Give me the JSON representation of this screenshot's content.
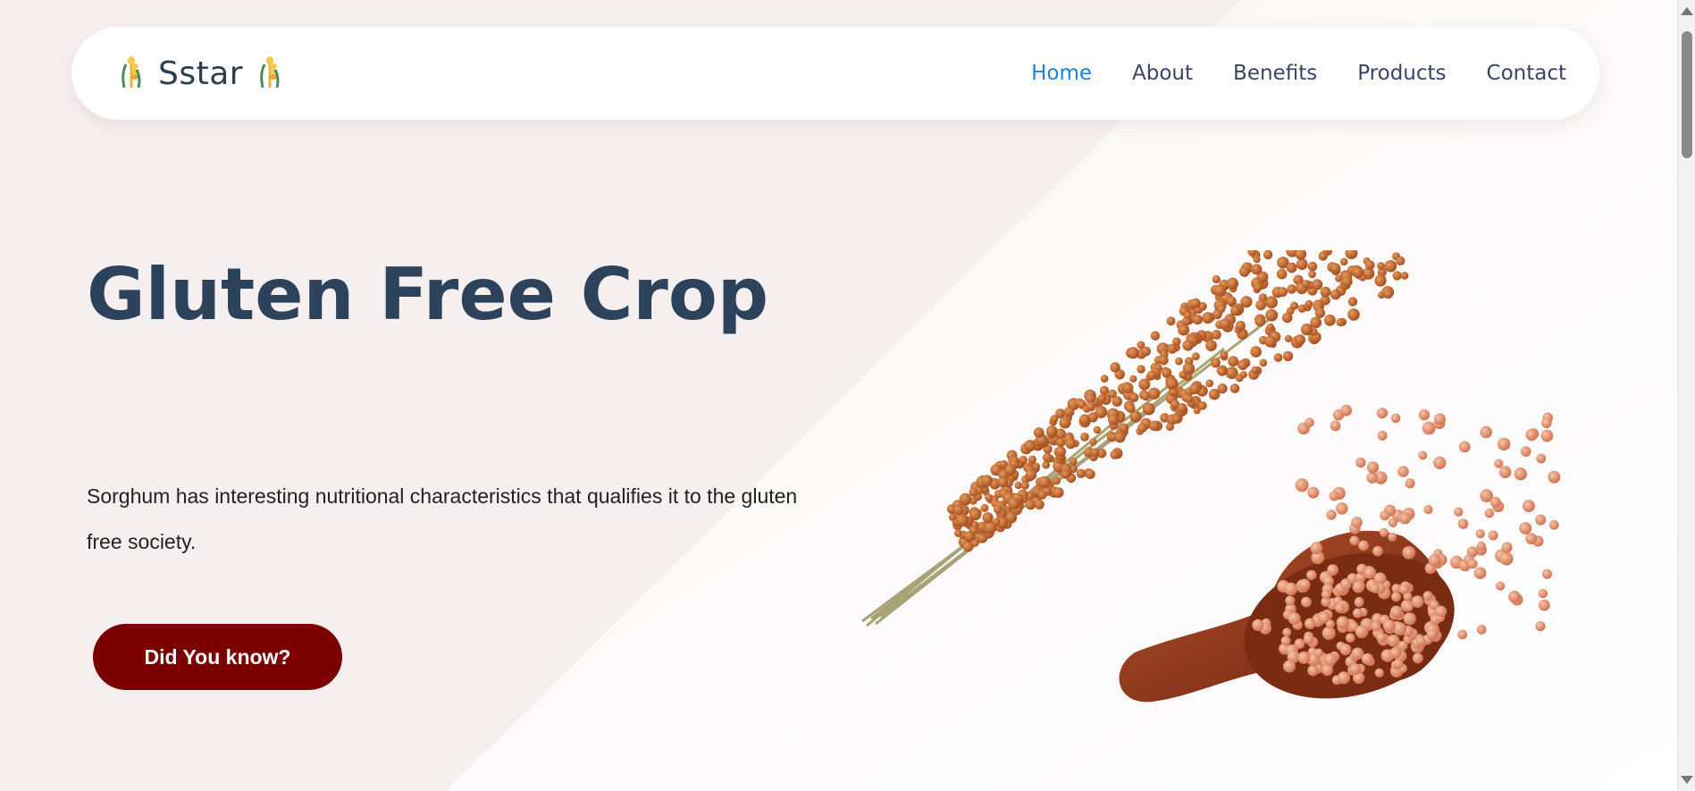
{
  "brand": {
    "name": "Sstar",
    "icon": "wheat-icon"
  },
  "nav": {
    "items": [
      {
        "label": "Home",
        "active": true
      },
      {
        "label": "About",
        "active": false
      },
      {
        "label": "Benefits",
        "active": false
      },
      {
        "label": "Products",
        "active": false
      },
      {
        "label": "Contact",
        "active": false
      }
    ]
  },
  "hero": {
    "title": "Gluten Free Crop",
    "description": "Sorghum has interesting nutritional characteristics that qualifies it to the gluten free society.",
    "cta_label": "Did You know?",
    "image": "sorghum-grain-illustration"
  },
  "colors": {
    "accent": "#1f7fd6",
    "cta": "#7c0000",
    "title": "#2d435c",
    "background": "#f6eff0"
  }
}
